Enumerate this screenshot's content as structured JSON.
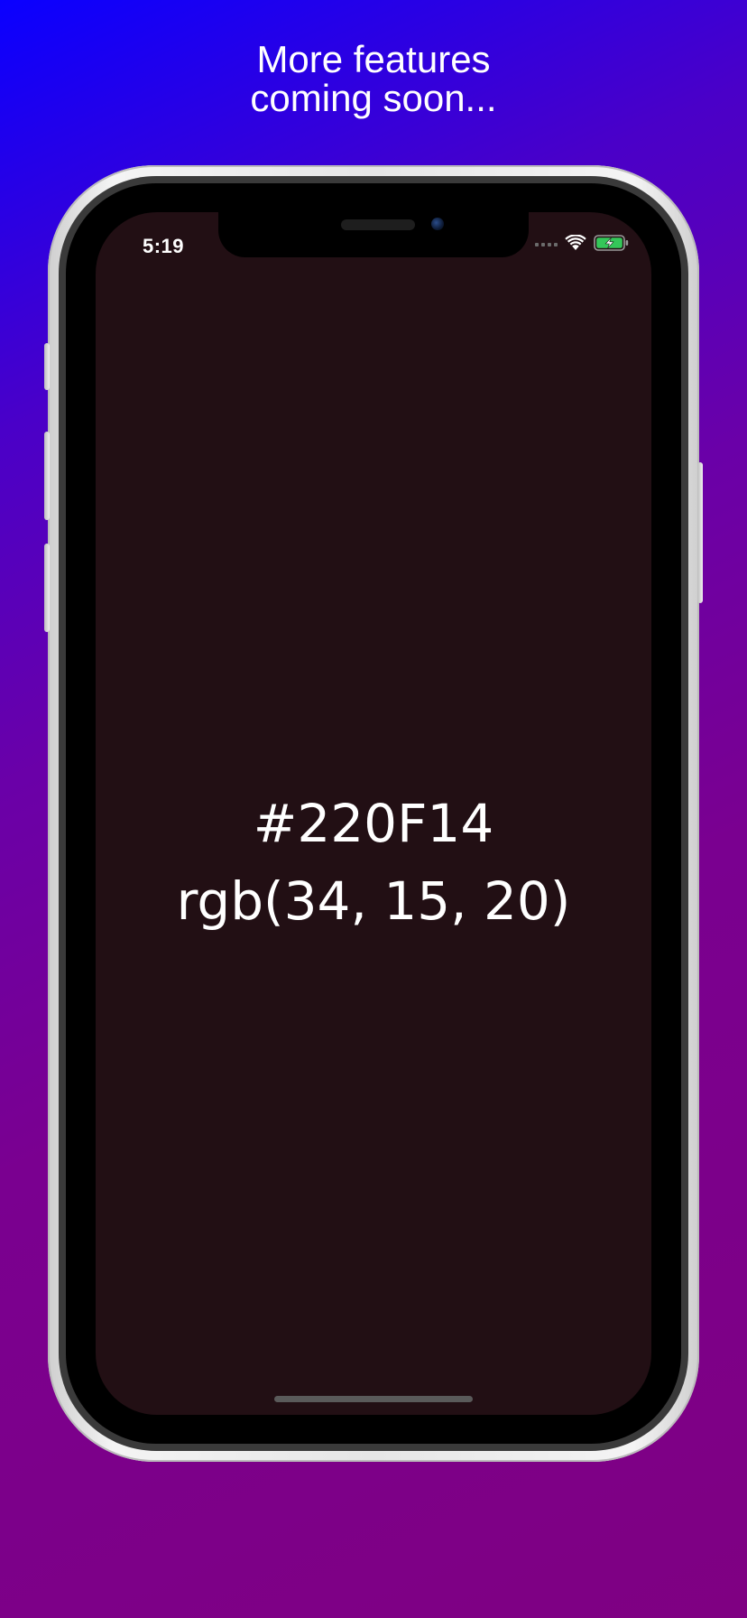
{
  "promo": {
    "line1": "More features",
    "line2": "coming soon..."
  },
  "status_bar": {
    "time": "5:19",
    "signal_icon": "cellular-signal-icon",
    "wifi_icon": "wifi-icon",
    "battery_icon": "battery-charging-icon"
  },
  "color": {
    "hex": "#220F14",
    "rgb": "rgb(34, 15, 20)",
    "background": "#220f14"
  },
  "colors": {
    "gradient_top_left": "#0a00ff",
    "gradient_bottom_right": "#7f0082",
    "battery_fill": "#34c759"
  }
}
